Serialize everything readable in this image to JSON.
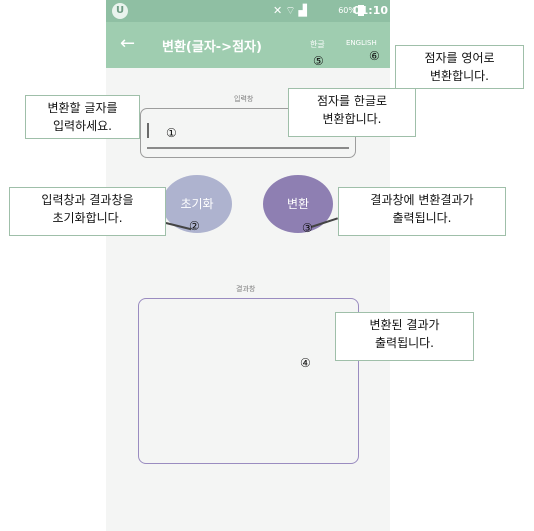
{
  "status_bar": {
    "app_badge": "U",
    "battery_percent": "60%",
    "time": "01:10",
    "icons": [
      "mute-icon",
      "wifi-icon",
      "signal-icon",
      "battery-icon"
    ]
  },
  "app_bar": {
    "back_icon": "←",
    "title": "변환(글자->점자)",
    "lang_korean": "한글",
    "lang_english": "ENGLISH",
    "color": "#9fcdb0"
  },
  "input": {
    "label": "입력창",
    "value": ""
  },
  "buttons": {
    "reset_label": "초기화",
    "convert_label": "변환",
    "reset_color": "#aeb3cf",
    "convert_color": "#8e7fb2"
  },
  "result": {
    "label": "결과창",
    "value": ""
  },
  "annotations": {
    "a1": {
      "marker": "①",
      "text1": "변환할 글자를",
      "text2": "입력하세요."
    },
    "a2": {
      "marker": "②",
      "text1": "입력창과 결과창을",
      "text2": "초기화합니다."
    },
    "a3": {
      "marker": "③",
      "text1": "결과창에 변환결과가",
      "text2": "출력됩니다."
    },
    "a4": {
      "marker": "④",
      "text1": "변환된 결과가",
      "text2": "출력됩니다."
    },
    "a5": {
      "marker": "⑤",
      "text1": "점자를 한글로",
      "text2": "변환합니다."
    },
    "a6": {
      "marker": "⑥",
      "text1": "점자를 영어로",
      "text2": "변환합니다."
    }
  }
}
